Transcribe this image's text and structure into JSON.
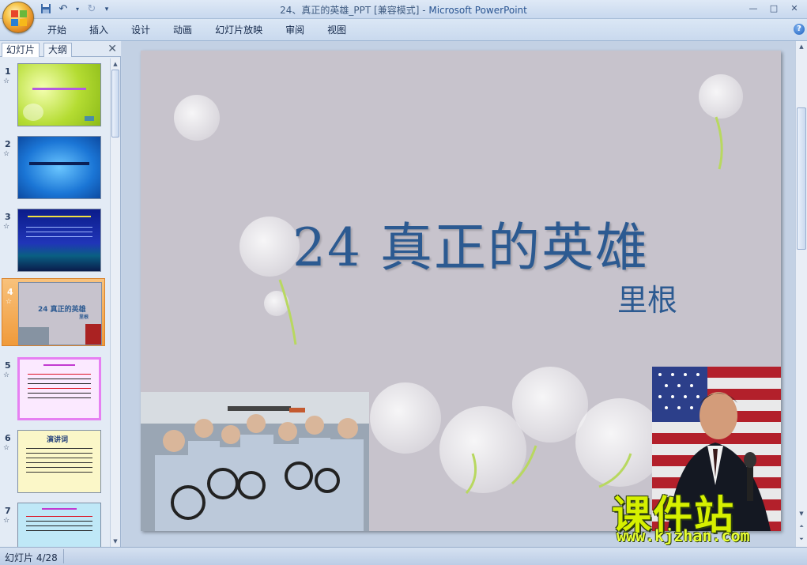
{
  "window": {
    "title_doc": "24、真正的英雄_PPT [兼容模式] - ",
    "title_app": "Microsoft PowerPoint",
    "controls": [
      "—",
      "□",
      "✕"
    ]
  },
  "ribbon": {
    "tabs": [
      "开始",
      "插入",
      "设计",
      "动画",
      "幻灯片放映",
      "审阅",
      "视图"
    ],
    "help": "?"
  },
  "left_pane": {
    "tab_slides": "幻灯片",
    "tab_outline": "大纲",
    "close": "✕",
    "thumbnails": [
      {
        "num": "1",
        "star": "☆"
      },
      {
        "num": "2",
        "star": "☆"
      },
      {
        "num": "3",
        "star": "☆"
      },
      {
        "num": "4",
        "star": "☆",
        "title": "24 真正的英雄",
        "author": "里根"
      },
      {
        "num": "5",
        "star": "☆"
      },
      {
        "num": "6",
        "star": "☆",
        "heading": "演讲词"
      },
      {
        "num": "7",
        "star": "☆"
      }
    ]
  },
  "slide": {
    "title": "24 真正的英雄",
    "author": "里根"
  },
  "status": {
    "slide_counter": "幻灯片 4/28"
  },
  "watermark": {
    "main": "课件站",
    "url": "www.kjzhan.com"
  }
}
